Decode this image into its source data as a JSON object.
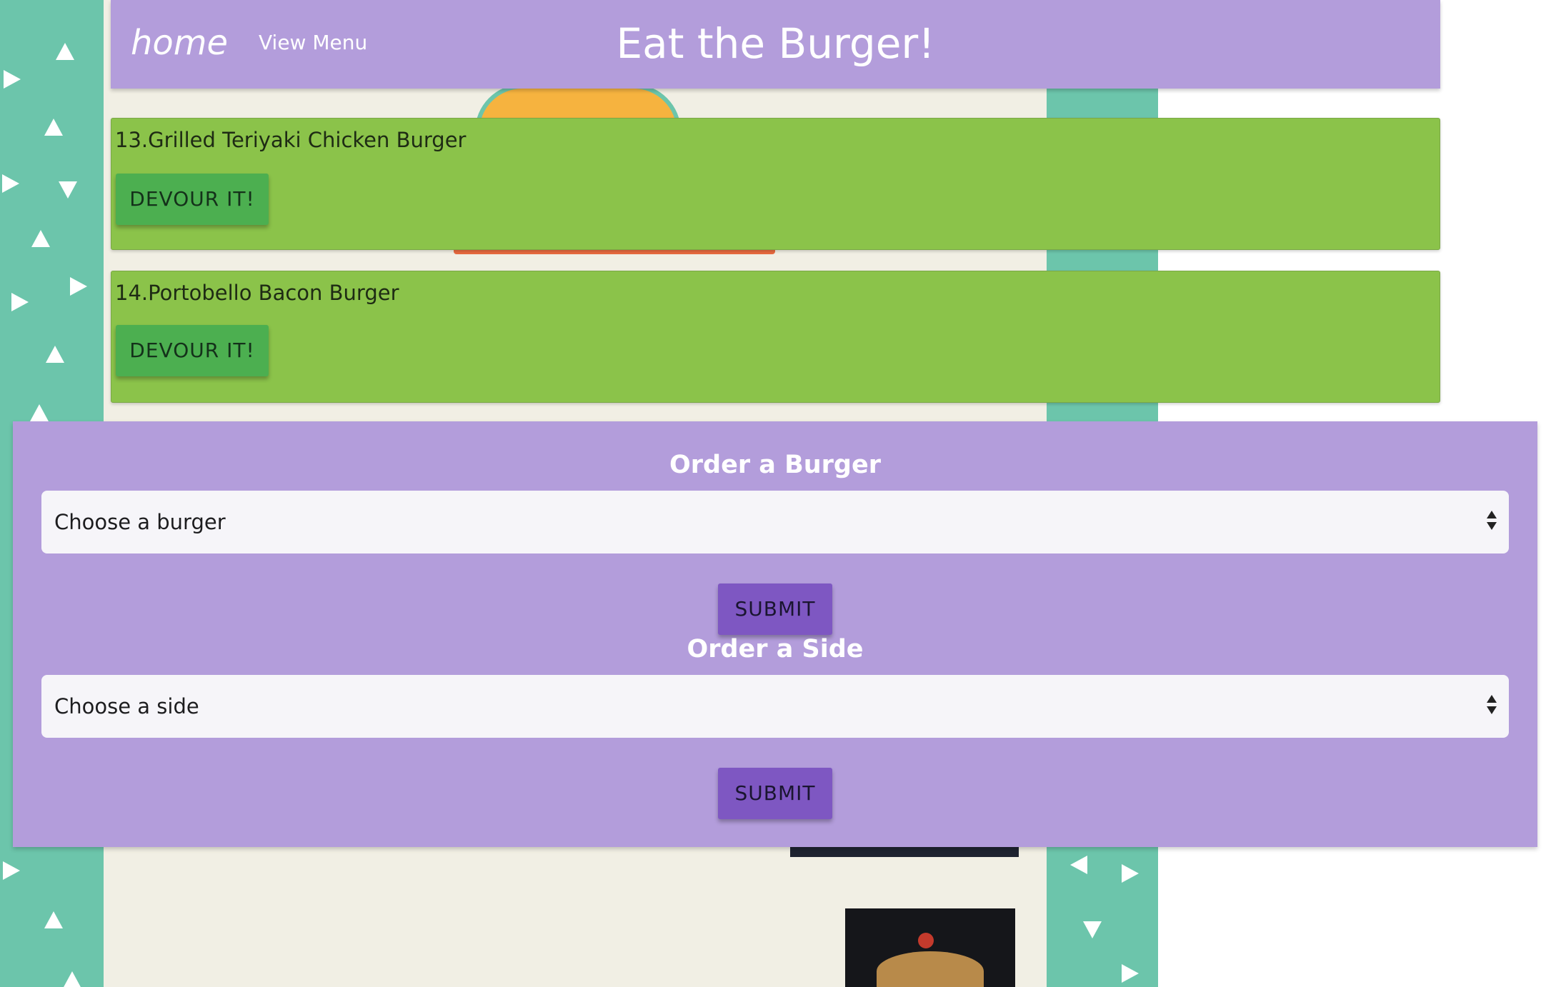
{
  "header": {
    "brand": "home",
    "nav_link": "View Menu",
    "title": "Eat the Burger!"
  },
  "burgers": [
    {
      "name": "13.Grilled Teriyaki Chicken Burger",
      "button": "DEVOUR IT!"
    },
    {
      "name": "14.Portobello Bacon Burger",
      "button": "DEVOUR IT!"
    }
  ],
  "order_burger": {
    "title": "Order a Burger",
    "select_value": "Choose a burger",
    "submit": "SUBMIT"
  },
  "order_side": {
    "title": "Order a Side",
    "select_value": "Choose a side",
    "submit": "SUBMIT"
  },
  "colors": {
    "header": "#b39ddb",
    "card": "#8bc34a",
    "devour_button": "#4caf50",
    "submit_button": "#7e57c2",
    "background_pattern": "#6cc5ab",
    "paper": "#f1efe4"
  }
}
